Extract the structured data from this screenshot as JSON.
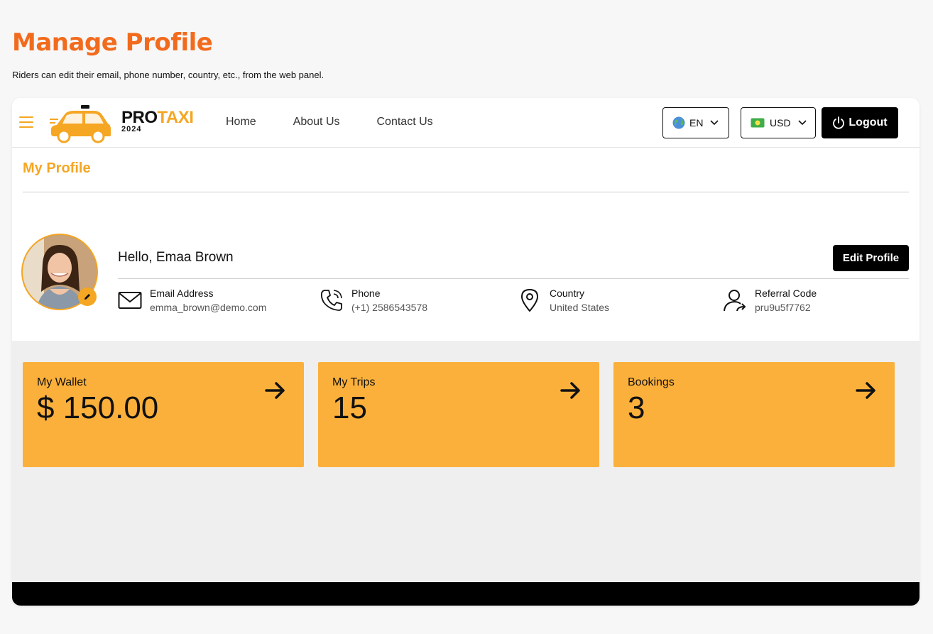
{
  "page": {
    "title": "Manage Profile",
    "subtitle": "Riders can edit their email, phone number, country, etc., from the web panel."
  },
  "navbar": {
    "brand_pro": "PRO",
    "brand_taxi": "TAXI",
    "brand_year": "2024",
    "links": [
      "Home",
      "About Us",
      "Contact Us"
    ],
    "language": "EN",
    "currency": "USD",
    "logout_label": "Logout"
  },
  "profile": {
    "section_title": "My Profile",
    "greeting": "Hello, Emaa Brown",
    "edit_label": "Edit Profile",
    "email_label": "Email Address",
    "email_value": "emma_brown@demo.com",
    "phone_label": "Phone",
    "phone_value": "(+1) 2586543578",
    "country_label": "Country",
    "country_value": "United States",
    "referral_label": "Referral Code",
    "referral_value": "pru9u5f7762"
  },
  "cards": [
    {
      "label": "My Wallet",
      "value": "$ 150.00"
    },
    {
      "label": "My Trips",
      "value": "15"
    },
    {
      "label": "Bookings",
      "value": "3"
    }
  ],
  "colors": {
    "accent": "#f5a623",
    "title_orange": "#f26b1d",
    "card_bg": "#fbb03b"
  },
  "icons": {
    "menu": "hamburger-icon",
    "email": "envelope-icon",
    "phone": "phone-icon",
    "country": "location-pin-icon",
    "referral": "user-share-icon",
    "card_arrow": "arrow-right-icon"
  }
}
